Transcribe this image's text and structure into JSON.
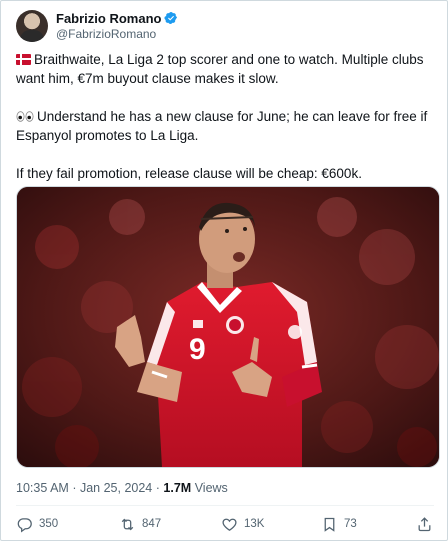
{
  "author": {
    "name": "Fabrizio Romano",
    "handle": "@FabrizioRomano",
    "verified": true
  },
  "tweet": {
    "flag_icon": "denmark-flag",
    "paragraph1": "Braithwaite, La Liga 2 top scorer and one to watch. Multiple clubs want him, €7m buyout clause makes it slow.",
    "eyes_icon": "eyes-emoji",
    "paragraph2": "Understand he has a new clause for June; he can leave for free if Espanyol promotes to La Liga.",
    "paragraph3": "If they fail promotion, release clause will be cheap: €600k."
  },
  "media": {
    "shirt_number": "9"
  },
  "meta": {
    "time": "10:35 AM",
    "separator": "·",
    "date": "Jan 25, 2024",
    "views_count": "1.7M",
    "views_label": "Views"
  },
  "actions": {
    "replies": "350",
    "reposts": "847",
    "likes": "13K",
    "bookmarks": "73"
  },
  "colors": {
    "verified": "#1d9bf0",
    "text": "#0f1419",
    "muted": "#536471",
    "shirt_red": "#c8102e"
  }
}
